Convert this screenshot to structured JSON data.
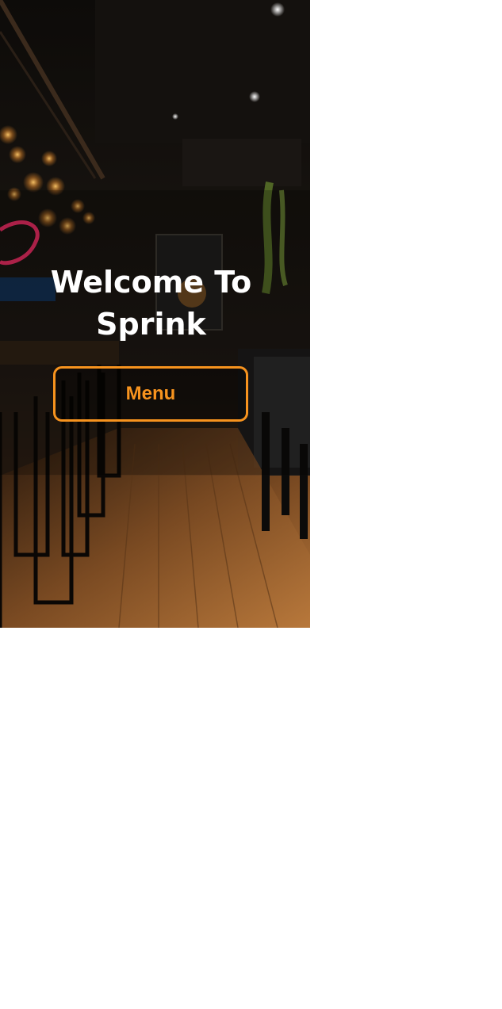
{
  "hero": {
    "background_image": "restaurant-interior-photo",
    "welcome_line1": "Welcome To",
    "welcome_line2": "Sprink",
    "menu_button_label": "Menu"
  },
  "colors": {
    "accent": "#f7931e",
    "heading": "#ffffff",
    "page_background": "#ffffff"
  }
}
